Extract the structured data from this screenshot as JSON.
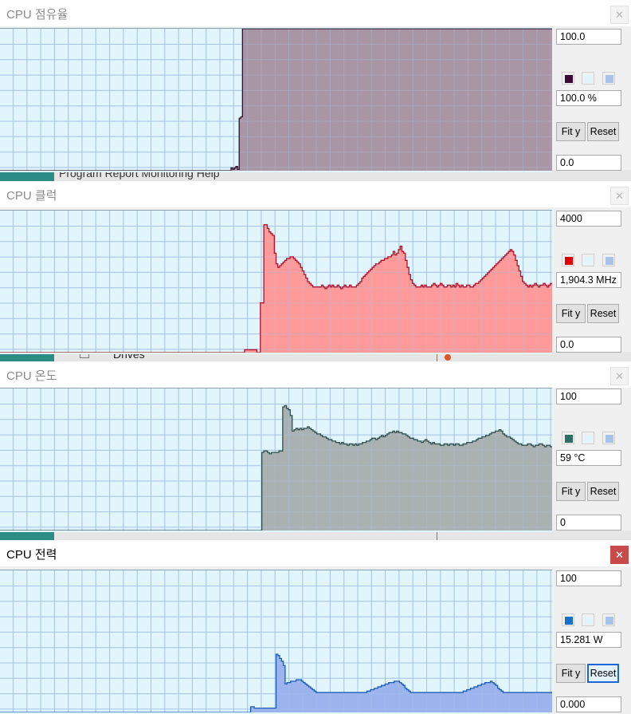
{
  "background_fragments": {
    "menu_text": "Program  Report  Monitoring  Help",
    "tree_text": "Drives"
  },
  "windows": [
    {
      "title": "CPU 점유율",
      "close_label": "✕",
      "active": false,
      "y_max": "100.0",
      "y_min": "0.0",
      "current_value": "100.0 %",
      "fit_label": "Fit y",
      "reset_label": "Reset",
      "line_color": "#2b0f2b",
      "fill_color": "#a896a5",
      "swatch_colors": [
        "#3a0a3a",
        "#e0f6fc",
        "#a9c3e8"
      ],
      "series": [
        0,
        0,
        0,
        0,
        0,
        0,
        0,
        0,
        0,
        0,
        0,
        0,
        0,
        0,
        0,
        0,
        0,
        0,
        0,
        0,
        0,
        0,
        0,
        0,
        0,
        0,
        0,
        0,
        0,
        0,
        0,
        0,
        0,
        0,
        0,
        0,
        0,
        0,
        0,
        0,
        0,
        0,
        0,
        0,
        0,
        0,
        0,
        0,
        0,
        0,
        0,
        0,
        0,
        0,
        0,
        0,
        0,
        0,
        0,
        0,
        0,
        0,
        0,
        0,
        0,
        0,
        0,
        0,
        0,
        0,
        0,
        0,
        0,
        0,
        0,
        0,
        0,
        0,
        0,
        0,
        0,
        0,
        0,
        0,
        0,
        0,
        0,
        0,
        0,
        0,
        0,
        0,
        0,
        0,
        0,
        0,
        0,
        0,
        0,
        0,
        0,
        0,
        0,
        0,
        0,
        0,
        0,
        0,
        0,
        0,
        0,
        0,
        0,
        0,
        0,
        0,
        0,
        0,
        0,
        0,
        0,
        0,
        0,
        0,
        0,
        0,
        0,
        0,
        0,
        0,
        0,
        0,
        0,
        0,
        0,
        0,
        0,
        0,
        0,
        0,
        0,
        2,
        1,
        2,
        3,
        1,
        37,
        38,
        100,
        100,
        100,
        100,
        100,
        100,
        100,
        100,
        100,
        100,
        100,
        100,
        100,
        100,
        100,
        100,
        100,
        100,
        100,
        100,
        100,
        100,
        100,
        100,
        100,
        100,
        100,
        100,
        100,
        100,
        100,
        100,
        100,
        100,
        100,
        100,
        100,
        100,
        100,
        100,
        100,
        100,
        100,
        100,
        100,
        100,
        100,
        100,
        100,
        100,
        100,
        100,
        100,
        100,
        100,
        100,
        100,
        100,
        100,
        100,
        100,
        100,
        100,
        100,
        100,
        100,
        100,
        100,
        100,
        100,
        100,
        100,
        100,
        100,
        100,
        100,
        100,
        100,
        100,
        100,
        100,
        100,
        100,
        100,
        100,
        100,
        100,
        100,
        100,
        100,
        100,
        100,
        100,
        100,
        100,
        100,
        100,
        100,
        100,
        100,
        100,
        100,
        100,
        100,
        100,
        100,
        100,
        100,
        100,
        100,
        100,
        100,
        100,
        100,
        100,
        100,
        100,
        100,
        100,
        100,
        100,
        100,
        100,
        100,
        100,
        100,
        100,
        100,
        100,
        100,
        100,
        100,
        100,
        100,
        100,
        100,
        100,
        100,
        100,
        100,
        100,
        100,
        100,
        100,
        100,
        100,
        100,
        100,
        100,
        100,
        100,
        100,
        100,
        100,
        100,
        100,
        100,
        100,
        100,
        100,
        100,
        100,
        100,
        100,
        100,
        100,
        100,
        100,
        100,
        100,
        100,
        100,
        100,
        100,
        100,
        100,
        100,
        100,
        100,
        100,
        100,
        100,
        100,
        100,
        100,
        100,
        100,
        100,
        100
      ]
    },
    {
      "title": "CPU 클럭",
      "close_label": "✕",
      "active": false,
      "y_max": "4000",
      "y_min": "0.0",
      "current_value": "1,904.3 MHz",
      "fit_label": "Fit y",
      "reset_label": "Reset",
      "line_color": "#b0102a",
      "fill_color": "#ff9a9a",
      "swatch_colors": [
        "#e00000",
        "#e0f6fc",
        "#a9c3e8"
      ],
      "series": [
        0,
        0,
        0,
        0,
        0,
        0,
        0,
        0,
        0,
        0,
        0,
        0,
        0,
        0,
        0,
        0,
        0,
        0,
        0,
        0,
        0,
        0,
        0,
        0,
        0,
        0,
        0,
        0,
        0,
        0,
        0,
        0,
        0,
        0,
        0,
        0,
        0,
        0,
        0,
        0,
        0,
        0,
        0,
        0,
        0,
        0,
        0,
        0,
        0,
        0,
        0,
        0,
        0,
        0,
        0,
        0,
        0,
        0,
        0,
        0,
        0,
        0,
        0,
        0,
        0,
        0,
        0,
        0,
        0,
        0,
        0,
        0,
        0,
        0,
        0,
        0,
        0,
        0,
        0,
        0,
        0,
        0,
        0,
        0,
        0,
        0,
        0,
        0,
        0,
        0,
        0,
        0,
        0,
        0,
        0,
        0,
        0,
        0,
        0,
        0,
        0,
        0,
        0,
        0,
        0,
        0,
        0,
        0,
        0,
        0,
        0,
        0,
        0,
        0,
        0,
        0,
        0,
        0,
        0,
        0,
        0,
        0,
        0,
        0,
        0,
        0,
        0,
        0,
        0,
        0,
        0,
        0,
        0,
        0,
        0,
        0,
        0,
        0,
        0,
        0,
        80,
        80,
        80,
        80,
        80,
        80,
        80,
        0,
        0,
        1400,
        1400,
        3600,
        3600,
        3500,
        3400,
        3350,
        3300,
        2800,
        2500,
        2400,
        2450,
        2500,
        2550,
        2600,
        2650,
        2650,
        2700,
        2700,
        2650,
        2600,
        2550,
        2500,
        2400,
        2300,
        2200,
        2100,
        2000,
        1950,
        1900,
        1850,
        1850,
        1850,
        1850,
        1850,
        1900,
        1850,
        1800,
        1850,
        1900,
        1850,
        1900,
        1850,
        1850,
        1900,
        1850,
        1800,
        1850,
        1900,
        1850,
        1850,
        1900,
        1850,
        1850,
        1850,
        1900,
        1950,
        2000,
        2100,
        2150,
        2200,
        2250,
        2300,
        2350,
        2400,
        2450,
        2500,
        2500,
        2550,
        2600,
        2600,
        2650,
        2650,
        2700,
        2700,
        2750,
        2850,
        2750,
        2800,
        2900,
        3000,
        2850,
        2800,
        2600,
        2400,
        2200,
        2050,
        1950,
        1900,
        1850,
        1850,
        1850,
        1900,
        1850,
        1900,
        1850,
        1850,
        1850,
        1900,
        1950,
        1900,
        1850,
        1900,
        1950,
        1900,
        1850,
        1850,
        1900,
        1900,
        1850,
        1900,
        1850,
        1950,
        1900,
        1850,
        1900,
        1850,
        1850,
        1900,
        1900,
        1850,
        1850,
        1900,
        1950,
        1950,
        2000,
        2050,
        2100,
        2150,
        2200,
        2250,
        2300,
        2350,
        2400,
        2450,
        2500,
        2550,
        2600,
        2650,
        2700,
        2750,
        2800,
        2850,
        2900,
        2850,
        2750,
        2600,
        2450,
        2300,
        2150,
        2000,
        1950,
        1900,
        1850,
        1900,
        1850,
        1900,
        1950,
        1900,
        1850,
        1900,
        1900,
        1950,
        1900,
        1850,
        1900,
        1950
      ]
    },
    {
      "title": "CPU 온도",
      "close_label": "✕",
      "active": false,
      "y_max": "100",
      "y_min": "0",
      "current_value": "59 °C",
      "fit_label": "Fit y",
      "reset_label": "Reset",
      "line_color": "#2f4f4f",
      "fill_color": "#aab1b1",
      "swatch_colors": [
        "#2e6e66",
        "#e0f6fc",
        "#a9c3e8"
      ],
      "series": [
        0,
        0,
        0,
        0,
        0,
        0,
        0,
        0,
        0,
        0,
        0,
        0,
        0,
        0,
        0,
        0,
        0,
        0,
        0,
        0,
        0,
        0,
        0,
        0,
        0,
        0,
        0,
        0,
        0,
        0,
        0,
        0,
        0,
        0,
        0,
        0,
        0,
        0,
        0,
        0,
        0,
        0,
        0,
        0,
        0,
        0,
        0,
        0,
        0,
        0,
        0,
        0,
        0,
        0,
        0,
        0,
        0,
        0,
        0,
        0,
        0,
        0,
        0,
        0,
        0,
        0,
        0,
        0,
        0,
        0,
        0,
        0,
        0,
        0,
        0,
        0,
        0,
        0,
        0,
        0,
        0,
        0,
        0,
        0,
        0,
        0,
        0,
        0,
        0,
        0,
        0,
        0,
        0,
        0,
        0,
        0,
        0,
        0,
        0,
        0,
        0,
        0,
        0,
        0,
        0,
        0,
        0,
        0,
        0,
        0,
        0,
        0,
        0,
        0,
        0,
        0,
        0,
        0,
        0,
        0,
        0,
        0,
        0,
        0,
        0,
        0,
        0,
        0,
        0,
        0,
        0,
        0,
        0,
        0,
        0,
        0,
        0,
        0,
        55,
        56,
        56,
        55,
        54,
        55,
        55,
        55,
        55,
        56,
        56,
        87,
        88,
        86,
        85,
        81,
        70,
        71,
        72,
        71,
        72,
        71,
        72,
        72,
        73,
        72,
        71,
        70,
        69,
        68,
        68,
        67,
        66,
        66,
        65,
        64,
        64,
        63,
        63,
        62,
        62,
        61,
        62,
        61,
        61,
        60,
        61,
        61,
        60,
        61,
        60,
        61,
        61,
        62,
        62,
        63,
        63,
        64,
        65,
        65,
        64,
        65,
        66,
        67,
        66,
        67,
        68,
        69,
        69,
        70,
        69,
        70,
        69,
        69,
        68,
        68,
        67,
        66,
        65,
        65,
        64,
        64,
        63,
        63,
        62,
        63,
        64,
        63,
        62,
        61,
        62,
        61,
        61,
        61,
        60,
        60,
        61,
        61,
        60,
        61,
        61,
        60,
        61,
        61,
        60,
        60,
        61,
        61,
        62,
        62,
        62,
        63,
        63,
        64,
        65,
        65,
        66,
        66,
        67,
        67,
        68,
        69,
        69,
        70,
        70,
        71,
        70,
        68,
        67,
        66,
        66,
        65,
        64,
        63,
        62,
        61,
        61,
        60,
        60,
        60,
        61,
        61,
        60,
        59,
        60,
        60,
        61,
        61,
        60,
        59,
        60,
        60,
        59
      ]
    },
    {
      "title": "CPU 전력",
      "close_label": "✕",
      "active": true,
      "y_max": "100",
      "y_min": "0.000",
      "current_value": "15.281 W",
      "fit_label": "Fit y",
      "reset_label": "Reset",
      "line_color": "#1c5bb5",
      "fill_color": "#9cb4ee",
      "swatch_colors": [
        "#1870c8",
        "#e0f6fc",
        "#a9c3e8"
      ],
      "series": [
        0,
        0,
        0,
        0,
        0,
        0,
        0,
        0,
        0,
        0,
        0,
        0,
        0,
        0,
        0,
        0,
        0,
        0,
        0,
        0,
        0,
        0,
        0,
        0,
        0,
        0,
        0,
        0,
        0,
        0,
        0,
        0,
        0,
        0,
        0,
        0,
        0,
        0,
        0,
        0,
        0,
        0,
        0,
        0,
        0,
        0,
        0,
        0,
        0,
        0,
        0,
        0,
        0,
        0,
        0,
        0,
        0,
        0,
        0,
        0,
        0,
        0,
        0,
        0,
        0,
        0,
        0,
        0,
        0,
        0,
        0,
        0,
        0,
        0,
        0,
        0,
        0,
        0,
        0,
        0,
        0,
        0,
        0,
        0,
        0,
        0,
        0,
        0,
        0,
        0,
        0,
        0,
        0,
        0,
        0,
        0,
        0,
        0,
        0,
        0,
        0,
        0,
        0,
        0,
        0,
        0,
        0,
        0,
        0,
        0,
        0,
        0,
        0,
        0,
        0,
        0,
        0,
        0,
        0,
        0,
        0,
        0,
        0,
        0,
        0,
        0,
        0,
        0,
        0,
        0,
        0,
        0,
        0,
        0,
        0,
        0,
        0,
        0,
        4,
        4,
        3,
        3,
        3,
        3,
        3,
        3,
        3,
        3,
        3,
        3,
        3,
        3,
        41,
        40,
        38,
        36,
        33,
        20,
        21,
        21,
        22,
        22,
        22,
        23,
        23,
        23,
        22,
        21,
        20,
        19,
        18,
        17,
        16,
        15,
        14,
        14,
        14,
        14,
        14,
        14,
        14,
        14,
        14,
        14,
        14,
        14,
        14,
        14,
        14,
        14,
        14,
        14,
        14,
        14,
        14,
        14,
        14,
        14,
        14,
        14,
        14,
        14,
        15,
        15,
        16,
        16,
        17,
        17,
        18,
        18,
        19,
        19,
        20,
        20,
        21,
        21,
        21,
        22,
        22,
        22,
        21,
        20,
        19,
        17,
        16,
        15,
        14,
        14,
        14,
        14,
        14,
        14,
        14,
        14,
        14,
        14,
        14,
        14,
        14,
        14,
        14,
        14,
        14,
        14,
        14,
        14,
        14,
        14,
        14,
        14,
        14,
        14,
        14,
        14,
        14,
        15,
        15,
        16,
        16,
        17,
        17,
        18,
        18,
        19,
        19,
        20,
        20,
        21,
        21,
        21,
        22,
        21,
        20,
        19,
        17,
        16,
        15,
        14,
        14,
        14,
        14,
        14,
        14,
        14,
        14,
        14,
        14,
        14,
        14,
        14,
        14,
        14,
        14,
        14,
        14,
        14,
        14,
        14,
        14,
        14,
        14,
        14,
        14,
        14
      ]
    }
  ]
}
